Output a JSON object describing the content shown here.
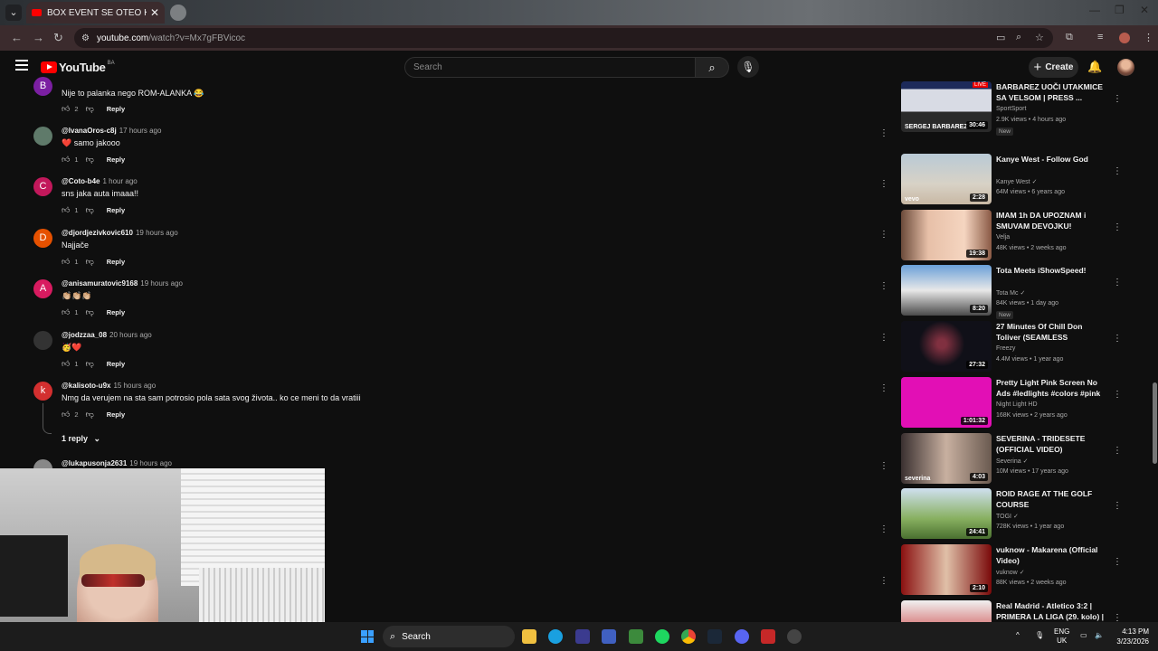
{
  "browser": {
    "tab_title": "BOX EVENT SE OTEO KONTROL",
    "url_host": "youtube.com",
    "url_path": "/watch?v=Mx7gFBVicoc"
  },
  "youtube": {
    "logo_text": "YouTube",
    "country_code": "BA",
    "search_placeholder": "Search",
    "create_label": "Create"
  },
  "comments": [
    {
      "avatar_letter": "B",
      "avatar_color": "#7b1fa2",
      "user": "",
      "time": "",
      "text": "Nije to palanka nego ROM-ALANKA 😂",
      "likes": "2"
    },
    {
      "avatar_letter": "",
      "avatar_color": "#5f7a6a",
      "user": "@IvanaOros-c8j",
      "time": "17 hours ago",
      "text": "❤️ samo jakooo",
      "likes": "1"
    },
    {
      "avatar_letter": "C",
      "avatar_color": "#c2185b",
      "user": "@Coto-b4e",
      "time": "1 hour ago",
      "text": "sns jaka auta imaaa!!",
      "likes": "1"
    },
    {
      "avatar_letter": "D",
      "avatar_color": "#e65100",
      "user": "@djordjezivkovic610",
      "time": "19 hours ago",
      "text": "Najjače",
      "likes": "1"
    },
    {
      "avatar_letter": "A",
      "avatar_color": "#d81b60",
      "user": "@anisamuratovic9168",
      "time": "19 hours ago",
      "text": "👏🏼👏🏼👏🏼",
      "likes": "1"
    },
    {
      "avatar_letter": "",
      "avatar_color": "#333333",
      "user": "@jodzzaa_08",
      "time": "20 hours ago",
      "text": "🥳❤️",
      "likes": "1"
    },
    {
      "avatar_letter": "k",
      "avatar_color": "#d32f2f",
      "user": "@kalisoto-u9x",
      "time": "15 hours ago",
      "text": "Nmg da verujem na sta sam potrosio pola sata svog života.. ko ce meni to da vratiii",
      "likes": "2"
    }
  ],
  "reply_label": "Reply",
  "replies_toggle": "1 reply",
  "partial_comment": {
    "user": "@lukapusonja2631",
    "time": "19 hours ago"
  },
  "videos": [
    {
      "title": "BARBAREZ UOČI UTAKMICE SA VELSOM | PRESS ...",
      "channel": "SportSport",
      "meta": "2.9K views • 4 hours ago",
      "duration": "30:46",
      "badge": "New",
      "thumb_label": "SERGEJ BARBAREZ",
      "live_label": "LIVE",
      "verified": false
    },
    {
      "title": "Kanye West - Follow God",
      "channel": "Kanye West",
      "meta": "64M views • 6 years ago",
      "duration": "2:28",
      "badge": "",
      "thumb_label": "vevo",
      "verified": true
    },
    {
      "title": "IMAM 1h DA UPOZNAM i SMUVAM DEVOJKU!",
      "channel": "Velja",
      "meta": "48K views • 2 weeks ago",
      "duration": "19:38",
      "badge": "",
      "verified": false
    },
    {
      "title": "Tota Meets iShowSpeed!",
      "channel": "Tota Mc",
      "meta": "84K views • 1 day ago",
      "duration": "8:20",
      "badge": "New",
      "verified": true
    },
    {
      "title": "27 Minutes Of Chill Don Toliver (SEAMLESS TRANSITIONS) ...",
      "channel": "Freezy",
      "meta": "4.4M views • 1 year ago",
      "duration": "27:32",
      "badge": "",
      "verified": false
    },
    {
      "title": "Pretty Light Pink Screen No Ads #ledlights #colors #pink #moo...",
      "channel": "Night Light HD",
      "meta": "168K views • 2 years ago",
      "duration": "1:01:32",
      "badge": "",
      "verified": false
    },
    {
      "title": "SEVERINA - TRIDESETE (OFFICIAL VIDEO)",
      "channel": "Severina",
      "meta": "10M views • 17 years ago",
      "duration": "4:03",
      "badge": "",
      "thumb_label": "severina",
      "verified": true
    },
    {
      "title": "ROID RAGE AT THE GOLF COURSE",
      "channel": "TOGI",
      "meta": "728K views • 1 year ago",
      "duration": "24:41",
      "badge": "",
      "verified": true
    },
    {
      "title": "vuknow - Makarena (Official Video)",
      "channel": "vuknow",
      "meta": "88K views • 2 weeks ago",
      "duration": "2:10",
      "badge": "",
      "verified": true
    },
    {
      "title": "Real Madrid - Atletico 3:2 | PRIMERA LA LIGA (29. kolo) | ...",
      "channel": "",
      "meta": "",
      "duration": "",
      "badge": "",
      "verified": false
    }
  ],
  "taskbar": {
    "search_label": "Search",
    "lang_line1": "ENG",
    "lang_line2": "UK",
    "time": "4:13 PM",
    "date": "3/23/2026"
  },
  "colors": {
    "youtube_red": "#ff0000",
    "background": "#0f0f0f",
    "pink_thumb": "#e20fb5"
  }
}
